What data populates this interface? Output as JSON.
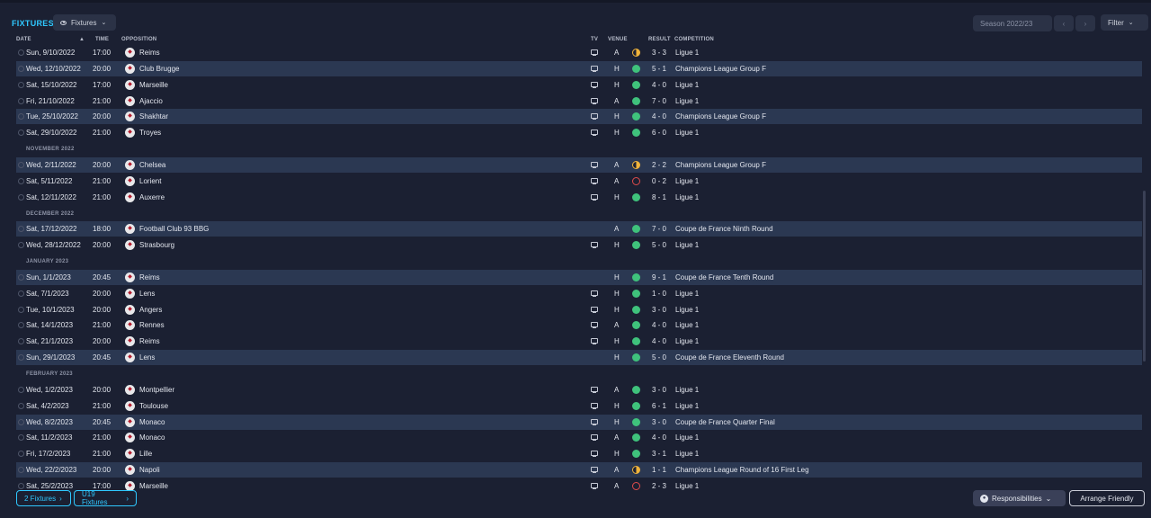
{
  "header": {
    "title": "FIXTURES",
    "view_button": "Fixtures",
    "season": "Season 2022/23",
    "filter": "Filter"
  },
  "columns": {
    "date": "DATE",
    "time": "TIME",
    "opposition": "OPPOSITION",
    "tv": "TV",
    "venue": "VENUE",
    "result": "RESULT",
    "competition": "COMPETITION"
  },
  "rows": [
    {
      "type": "match",
      "date": "Sun, 9/10/2022",
      "time": "17:00",
      "opposition": "Reims",
      "tv": true,
      "venue": "A",
      "outcome": "draw",
      "score": "3 - 3",
      "competition": "Ligue 1",
      "highlight": false
    },
    {
      "type": "match",
      "date": "Wed, 12/10/2022",
      "time": "20:00",
      "opposition": "Club Brugge",
      "tv": true,
      "venue": "H",
      "outcome": "win",
      "score": "5 - 1",
      "competition": "Champions League Group F",
      "highlight": true
    },
    {
      "type": "match",
      "date": "Sat, 15/10/2022",
      "time": "17:00",
      "opposition": "Marseille",
      "tv": true,
      "venue": "H",
      "outcome": "win",
      "score": "4 - 0",
      "competition": "Ligue 1",
      "highlight": false
    },
    {
      "type": "match",
      "date": "Fri, 21/10/2022",
      "time": "21:00",
      "opposition": "Ajaccio",
      "tv": true,
      "venue": "A",
      "outcome": "win",
      "score": "7 - 0",
      "competition": "Ligue 1",
      "highlight": false
    },
    {
      "type": "match",
      "date": "Tue, 25/10/2022",
      "time": "20:00",
      "opposition": "Shakhtar",
      "tv": true,
      "venue": "H",
      "outcome": "win",
      "score": "4 - 0",
      "competition": "Champions League Group F",
      "highlight": true
    },
    {
      "type": "match",
      "date": "Sat, 29/10/2022",
      "time": "21:00",
      "opposition": "Troyes",
      "tv": true,
      "venue": "H",
      "outcome": "win",
      "score": "6 - 0",
      "competition": "Ligue 1",
      "highlight": false
    },
    {
      "type": "month",
      "label": "NOVEMBER 2022"
    },
    {
      "type": "match",
      "date": "Wed, 2/11/2022",
      "time": "20:00",
      "opposition": "Chelsea",
      "tv": true,
      "venue": "A",
      "outcome": "draw",
      "score": "2 - 2",
      "competition": "Champions League Group F",
      "highlight": true
    },
    {
      "type": "match",
      "date": "Sat, 5/11/2022",
      "time": "21:00",
      "opposition": "Lorient",
      "tv": true,
      "venue": "A",
      "outcome": "loss",
      "score": "0 - 2",
      "competition": "Ligue 1",
      "highlight": false
    },
    {
      "type": "match",
      "date": "Sat, 12/11/2022",
      "time": "21:00",
      "opposition": "Auxerre",
      "tv": true,
      "venue": "H",
      "outcome": "win",
      "score": "8 - 1",
      "competition": "Ligue 1",
      "highlight": false
    },
    {
      "type": "month",
      "label": "DECEMBER 2022"
    },
    {
      "type": "match",
      "date": "Sat, 17/12/2022",
      "time": "18:00",
      "opposition": "Football Club 93 BBG",
      "tv": false,
      "venue": "A",
      "outcome": "win",
      "score": "7 - 0",
      "competition": "Coupe de France Ninth Round",
      "highlight": true
    },
    {
      "type": "match",
      "date": "Wed, 28/12/2022",
      "time": "20:00",
      "opposition": "Strasbourg",
      "tv": true,
      "venue": "H",
      "outcome": "win",
      "score": "5 - 0",
      "competition": "Ligue 1",
      "highlight": false
    },
    {
      "type": "month",
      "label": "JANUARY 2023"
    },
    {
      "type": "match",
      "date": "Sun, 1/1/2023",
      "time": "20:45",
      "opposition": "Reims",
      "tv": false,
      "venue": "H",
      "outcome": "win",
      "score": "9 - 1",
      "competition": "Coupe de France Tenth Round",
      "highlight": true
    },
    {
      "type": "match",
      "date": "Sat, 7/1/2023",
      "time": "20:00",
      "opposition": "Lens",
      "tv": true,
      "venue": "H",
      "outcome": "win",
      "score": "1 - 0",
      "competition": "Ligue 1",
      "highlight": false
    },
    {
      "type": "match",
      "date": "Tue, 10/1/2023",
      "time": "20:00",
      "opposition": "Angers",
      "tv": true,
      "venue": "H",
      "outcome": "win",
      "score": "3 - 0",
      "competition": "Ligue 1",
      "highlight": false
    },
    {
      "type": "match",
      "date": "Sat, 14/1/2023",
      "time": "21:00",
      "opposition": "Rennes",
      "tv": true,
      "venue": "A",
      "outcome": "win",
      "score": "4 - 0",
      "competition": "Ligue 1",
      "highlight": false
    },
    {
      "type": "match",
      "date": "Sat, 21/1/2023",
      "time": "20:00",
      "opposition": "Reims",
      "tv": true,
      "venue": "H",
      "outcome": "win",
      "score": "4 - 0",
      "competition": "Ligue 1",
      "highlight": false
    },
    {
      "type": "match",
      "date": "Sun, 29/1/2023",
      "time": "20:45",
      "opposition": "Lens",
      "tv": false,
      "venue": "H",
      "outcome": "win",
      "score": "5 - 0",
      "competition": "Coupe de France Eleventh Round",
      "highlight": true
    },
    {
      "type": "month",
      "label": "FEBRUARY 2023"
    },
    {
      "type": "match",
      "date": "Wed, 1/2/2023",
      "time": "20:00",
      "opposition": "Montpellier",
      "tv": true,
      "venue": "A",
      "outcome": "win",
      "score": "3 - 0",
      "competition": "Ligue 1",
      "highlight": false
    },
    {
      "type": "match",
      "date": "Sat, 4/2/2023",
      "time": "21:00",
      "opposition": "Toulouse",
      "tv": true,
      "venue": "H",
      "outcome": "win",
      "score": "6 - 1",
      "competition": "Ligue 1",
      "highlight": false
    },
    {
      "type": "match",
      "date": "Wed, 8/2/2023",
      "time": "20:45",
      "opposition": "Monaco",
      "tv": true,
      "venue": "H",
      "outcome": "win",
      "score": "3 - 0",
      "competition": "Coupe de France Quarter Final",
      "highlight": true
    },
    {
      "type": "match",
      "date": "Sat, 11/2/2023",
      "time": "21:00",
      "opposition": "Monaco",
      "tv": true,
      "venue": "A",
      "outcome": "win",
      "score": "4 - 0",
      "competition": "Ligue 1",
      "highlight": false
    },
    {
      "type": "match",
      "date": "Fri, 17/2/2023",
      "time": "21:00",
      "opposition": "Lille",
      "tv": true,
      "venue": "H",
      "outcome": "win",
      "score": "3 - 1",
      "competition": "Ligue 1",
      "highlight": false
    },
    {
      "type": "match",
      "date": "Wed, 22/2/2023",
      "time": "20:00",
      "opposition": "Napoli",
      "tv": true,
      "venue": "A",
      "outcome": "draw",
      "score": "1 - 1",
      "competition": "Champions League Round of 16 First Leg",
      "highlight": true
    },
    {
      "type": "match",
      "date": "Sat, 25/2/2023",
      "time": "17:00",
      "opposition": "Marseille",
      "tv": true,
      "venue": "A",
      "outcome": "loss",
      "score": "2 - 3",
      "competition": "Ligue 1",
      "highlight": false
    }
  ],
  "footer": {
    "fixtures_2": "2 Fixtures",
    "u19_fixtures": "U19 Fixtures",
    "responsibilities": "Responsibilities",
    "arrange_friendly": "Arrange Friendly"
  },
  "colors": {
    "accent": "#2fc8ff",
    "win": "#3fc27c",
    "draw": "#f0b33b",
    "loss": "#e04b4b",
    "row_highlight": "#2b3852",
    "background": "#1b2032"
  }
}
